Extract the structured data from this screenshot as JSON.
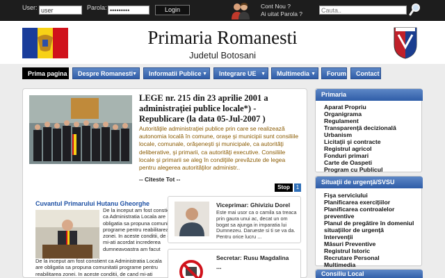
{
  "login": {
    "user_label": "User:",
    "user_value": "user",
    "pass_label": "Parola:",
    "pass_value": "•••••••••",
    "login_button": "Login",
    "new_account": "Cont Nou ?",
    "forgot": "Ai uitat Parola ?",
    "search_placeholder": "Cauta.."
  },
  "header": {
    "title": "Primaria Romanesti",
    "subtitle": "Judetul Botosani"
  },
  "nav": {
    "items": [
      "Prima pagina",
      "Despre Romanesti",
      "Informatii Publice",
      "Integrare UE",
      "Multimedia",
      "Forum",
      "Contact"
    ]
  },
  "featured": {
    "title": "LEGE nr. 215 din 23 aprilie 2001 a administraţiei publice locale*) - Republicare (la data 05-Jul-2007 )",
    "text": "Autorităţile administraţiei publice prin care se realizează autonomia locală în comune, oraşe şi municipii sunt consiliile locale, comunale, orăşeneşti şi municipale, ca autorităţi deliberative, şi primarii, ca autorităţi executive. Consiliile locale şi primarii se aleg în condiţiile prevăzute de legea pentru alegerea autorităţilor administr..",
    "more": "-- Citeste Tot --",
    "stop_button": "Stop",
    "page_number": "1"
  },
  "mayor": {
    "title": "Cuvantul Primarului Hutanu Gheorghe",
    "text": "De la inceput am fost constient ca Administratia Locala are obligatia sa propuna comunitatii programe pentru reabilitarea zonei. In aceste conditii, de cand mi-ati acordat increderea dumneavoastra am facut tot ce mi-a stat in putinta sa modernizez aceasta comuna si sa o aduc la nivelul demn de a se integra in Uniunea Europeana. Sunt convins ca in tot acest timp am reusit"
  },
  "vice": {
    "name": "Viceprimar: Ghiviziu Dorel",
    "text": "Este mai usor ca o camila sa treaca prin gaura unui ac, decat un om bogat sa ajunga in imparatia lui Dumnezeu. Darueste si ti se va da. Pentru orice lucru ..."
  },
  "secretary": {
    "name": "Secretar: Rusu Magdalina",
    "more": "..."
  },
  "sidebar": {
    "primaria_head": "Primaria",
    "primaria_links": [
      "Aparat Propriu",
      "Organigrama",
      "Regulament",
      "Transparenţă decizională",
      "Urbanism",
      "Licitaţii şi contracte",
      "Registrul agricol",
      "Fonduri primari",
      "Carte de Oaspeti",
      "Program cu Publicul"
    ],
    "urgenta_head": "Situaţii de urgenţă/SVSU",
    "urgenta_links": [
      "Fişa serviciului",
      "Planificarea exercițiilor",
      "Planificarea controalelor preventive",
      "Planul de pregătire în domeniul situaţiilor de urgenţă",
      "Intervenţii",
      "Măsuri Preventive",
      "Registrul Istoric",
      "Recrutare Personal",
      "Multimedia"
    ],
    "consiliu_head": "Consiliu Local"
  },
  "colors": {
    "nav_blue": "#2f5da8",
    "topbar": "#1d1d1d",
    "link_blue": "#1c4fa3",
    "featured_text": "#8a5a00"
  }
}
